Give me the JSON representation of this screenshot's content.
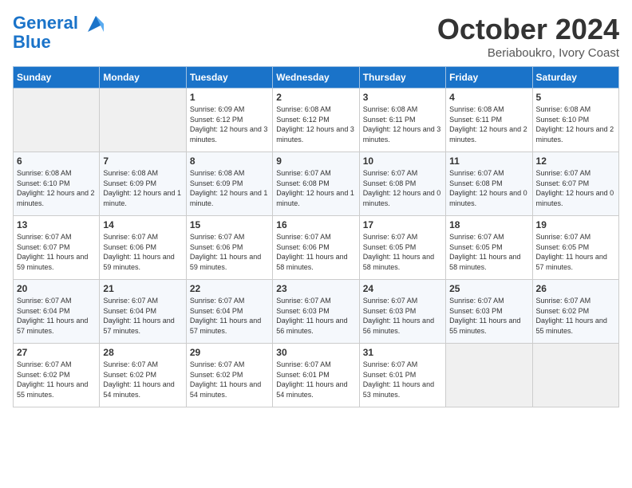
{
  "header": {
    "logo_line1": "General",
    "logo_line2": "Blue",
    "month": "October 2024",
    "location": "Beriaboukro, Ivory Coast"
  },
  "days_of_week": [
    "Sunday",
    "Monday",
    "Tuesday",
    "Wednesday",
    "Thursday",
    "Friday",
    "Saturday"
  ],
  "weeks": [
    [
      {
        "day": "",
        "info": ""
      },
      {
        "day": "",
        "info": ""
      },
      {
        "day": "1",
        "info": "Sunrise: 6:09 AM\nSunset: 6:12 PM\nDaylight: 12 hours and 3 minutes."
      },
      {
        "day": "2",
        "info": "Sunrise: 6:08 AM\nSunset: 6:12 PM\nDaylight: 12 hours and 3 minutes."
      },
      {
        "day": "3",
        "info": "Sunrise: 6:08 AM\nSunset: 6:11 PM\nDaylight: 12 hours and 3 minutes."
      },
      {
        "day": "4",
        "info": "Sunrise: 6:08 AM\nSunset: 6:11 PM\nDaylight: 12 hours and 2 minutes."
      },
      {
        "day": "5",
        "info": "Sunrise: 6:08 AM\nSunset: 6:10 PM\nDaylight: 12 hours and 2 minutes."
      }
    ],
    [
      {
        "day": "6",
        "info": "Sunrise: 6:08 AM\nSunset: 6:10 PM\nDaylight: 12 hours and 2 minutes."
      },
      {
        "day": "7",
        "info": "Sunrise: 6:08 AM\nSunset: 6:09 PM\nDaylight: 12 hours and 1 minute."
      },
      {
        "day": "8",
        "info": "Sunrise: 6:08 AM\nSunset: 6:09 PM\nDaylight: 12 hours and 1 minute."
      },
      {
        "day": "9",
        "info": "Sunrise: 6:07 AM\nSunset: 6:08 PM\nDaylight: 12 hours and 1 minute."
      },
      {
        "day": "10",
        "info": "Sunrise: 6:07 AM\nSunset: 6:08 PM\nDaylight: 12 hours and 0 minutes."
      },
      {
        "day": "11",
        "info": "Sunrise: 6:07 AM\nSunset: 6:08 PM\nDaylight: 12 hours and 0 minutes."
      },
      {
        "day": "12",
        "info": "Sunrise: 6:07 AM\nSunset: 6:07 PM\nDaylight: 12 hours and 0 minutes."
      }
    ],
    [
      {
        "day": "13",
        "info": "Sunrise: 6:07 AM\nSunset: 6:07 PM\nDaylight: 11 hours and 59 minutes."
      },
      {
        "day": "14",
        "info": "Sunrise: 6:07 AM\nSunset: 6:06 PM\nDaylight: 11 hours and 59 minutes."
      },
      {
        "day": "15",
        "info": "Sunrise: 6:07 AM\nSunset: 6:06 PM\nDaylight: 11 hours and 59 minutes."
      },
      {
        "day": "16",
        "info": "Sunrise: 6:07 AM\nSunset: 6:06 PM\nDaylight: 11 hours and 58 minutes."
      },
      {
        "day": "17",
        "info": "Sunrise: 6:07 AM\nSunset: 6:05 PM\nDaylight: 11 hours and 58 minutes."
      },
      {
        "day": "18",
        "info": "Sunrise: 6:07 AM\nSunset: 6:05 PM\nDaylight: 11 hours and 58 minutes."
      },
      {
        "day": "19",
        "info": "Sunrise: 6:07 AM\nSunset: 6:05 PM\nDaylight: 11 hours and 57 minutes."
      }
    ],
    [
      {
        "day": "20",
        "info": "Sunrise: 6:07 AM\nSunset: 6:04 PM\nDaylight: 11 hours and 57 minutes."
      },
      {
        "day": "21",
        "info": "Sunrise: 6:07 AM\nSunset: 6:04 PM\nDaylight: 11 hours and 57 minutes."
      },
      {
        "day": "22",
        "info": "Sunrise: 6:07 AM\nSunset: 6:04 PM\nDaylight: 11 hours and 57 minutes."
      },
      {
        "day": "23",
        "info": "Sunrise: 6:07 AM\nSunset: 6:03 PM\nDaylight: 11 hours and 56 minutes."
      },
      {
        "day": "24",
        "info": "Sunrise: 6:07 AM\nSunset: 6:03 PM\nDaylight: 11 hours and 56 minutes."
      },
      {
        "day": "25",
        "info": "Sunrise: 6:07 AM\nSunset: 6:03 PM\nDaylight: 11 hours and 55 minutes."
      },
      {
        "day": "26",
        "info": "Sunrise: 6:07 AM\nSunset: 6:02 PM\nDaylight: 11 hours and 55 minutes."
      }
    ],
    [
      {
        "day": "27",
        "info": "Sunrise: 6:07 AM\nSunset: 6:02 PM\nDaylight: 11 hours and 55 minutes."
      },
      {
        "day": "28",
        "info": "Sunrise: 6:07 AM\nSunset: 6:02 PM\nDaylight: 11 hours and 54 minutes."
      },
      {
        "day": "29",
        "info": "Sunrise: 6:07 AM\nSunset: 6:02 PM\nDaylight: 11 hours and 54 minutes."
      },
      {
        "day": "30",
        "info": "Sunrise: 6:07 AM\nSunset: 6:01 PM\nDaylight: 11 hours and 54 minutes."
      },
      {
        "day": "31",
        "info": "Sunrise: 6:07 AM\nSunset: 6:01 PM\nDaylight: 11 hours and 53 minutes."
      },
      {
        "day": "",
        "info": ""
      },
      {
        "day": "",
        "info": ""
      }
    ]
  ]
}
